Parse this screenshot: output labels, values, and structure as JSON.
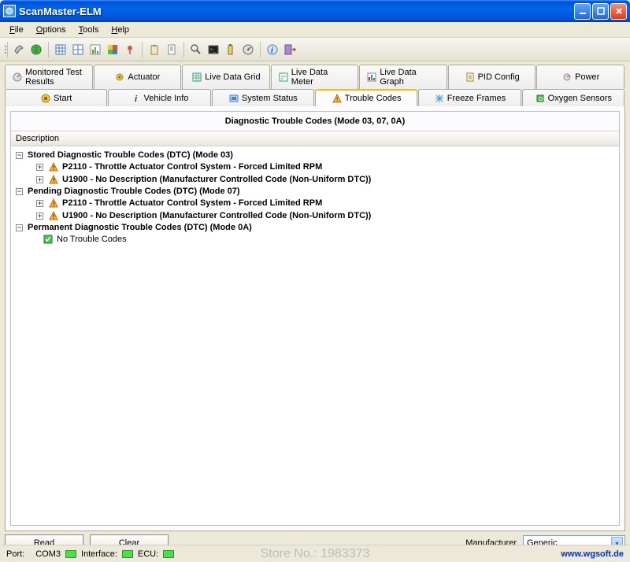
{
  "window": {
    "title": "ScanMaster-ELM"
  },
  "menu": {
    "file": "File",
    "options": "Options",
    "tools": "Tools",
    "help": "Help"
  },
  "tabs_row1": {
    "monitored": "Monitored Test Results",
    "actuator": "Actuator",
    "livegrid": "Live Data Grid",
    "livemeter": "Live Data Meter",
    "livegraph": "Live Data Graph",
    "pidconfig": "PID Config",
    "power": "Power"
  },
  "tabs_row2": {
    "start": "Start",
    "vehicle": "Vehicle Info",
    "system": "System Status",
    "trouble": "Trouble Codes",
    "freeze": "Freeze Frames",
    "oxygen": "Oxygen Sensors"
  },
  "panel": {
    "title": "Diagnostic Trouble Codes (Mode 03, 07, 0A)",
    "column": "Description"
  },
  "tree": {
    "stored_header": "Stored Diagnostic Trouble Codes (DTC) (Mode 03)",
    "stored_1": "P2110 - Throttle Actuator Control System - Forced Limited RPM",
    "stored_2": "U1900 - No Description (Manufacturer Controlled Code (Non-Uniform DTC))",
    "pending_header": "Pending Diagnostic Trouble Codes (DTC) (Mode 07)",
    "pending_1": "P2110 - Throttle Actuator Control System - Forced Limited RPM",
    "pending_2": "U1900 - No Description (Manufacturer Controlled Code (Non-Uniform DTC))",
    "permanent_header": "Permanent Diagnostic Trouble Codes (DTC) (Mode 0A)",
    "permanent_1": "No Trouble Codes"
  },
  "buttons": {
    "read": "Read",
    "clear": "Clear"
  },
  "manufacturer": {
    "label": "Manufacturer",
    "value": "Generic"
  },
  "status": {
    "port_label": "Port:",
    "port_value": "COM3",
    "interface_label": "Interface:",
    "ecu_label": "ECU:",
    "watermark": "Store No.: 1983373",
    "link": "www.wgsoft.de"
  }
}
